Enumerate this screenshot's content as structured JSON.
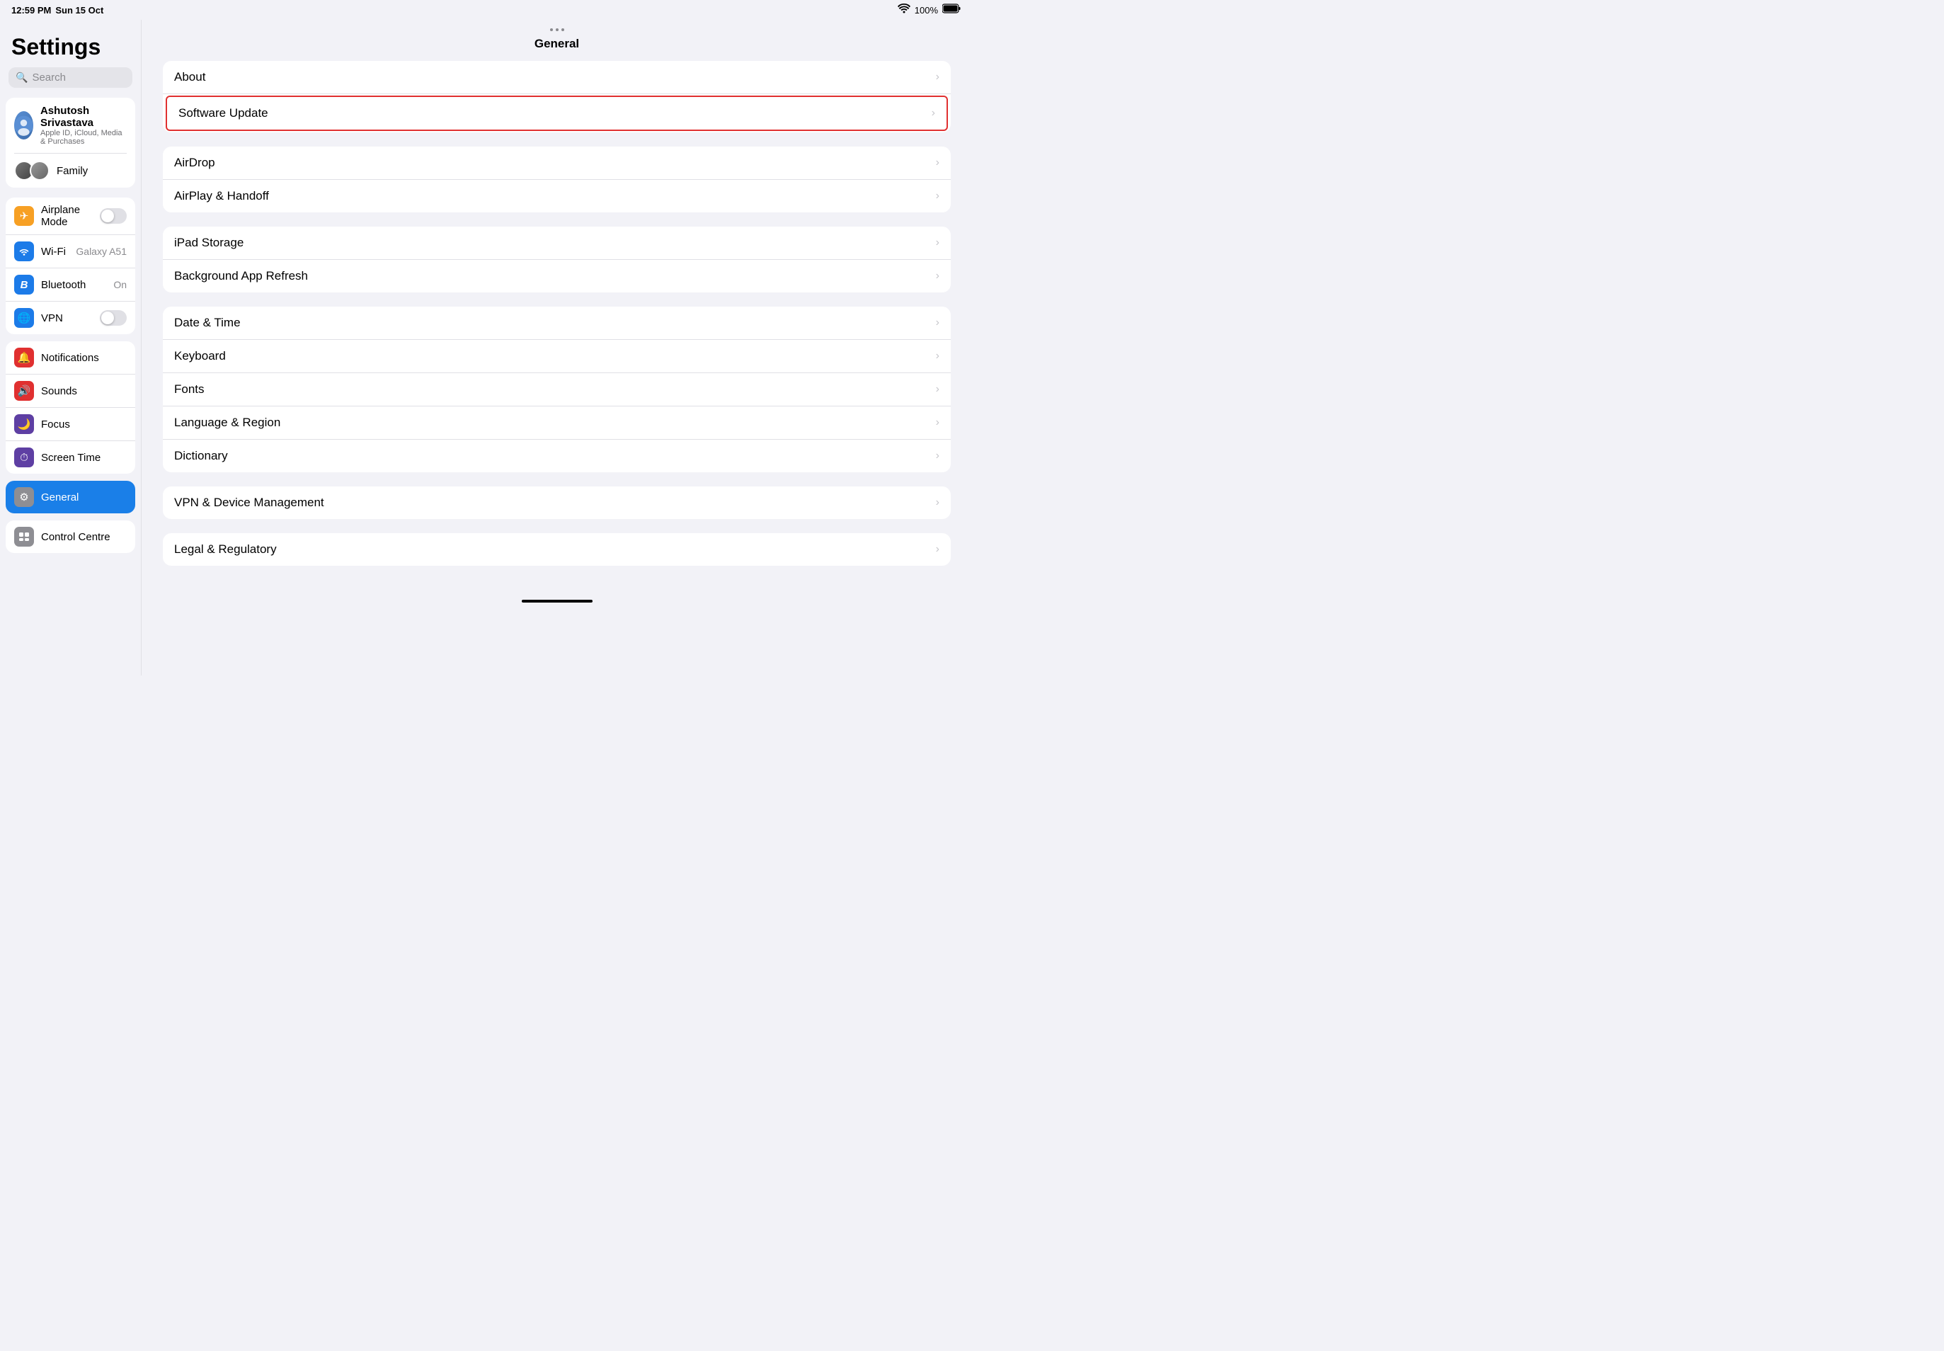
{
  "statusBar": {
    "time": "12:59 PM",
    "date": "Sun 15 Oct",
    "wifi": "100%",
    "battery": "100%"
  },
  "sidebar": {
    "title": "Settings",
    "search": {
      "placeholder": "Search"
    },
    "profile": {
      "name": "Ashutosh Srivastava",
      "subtitle": "Apple ID, iCloud, Media & Purchases",
      "family": "Family"
    },
    "groups": [
      {
        "items": [
          {
            "id": "airplane",
            "icon": "✈",
            "iconBg": "#f7a024",
            "label": "Airplane Mode",
            "type": "toggle",
            "toggleOn": false
          },
          {
            "id": "wifi",
            "icon": "📶",
            "iconBg": "#1c7be8",
            "label": "Wi-Fi",
            "value": "Galaxy A51",
            "type": "nav"
          },
          {
            "id": "bluetooth",
            "icon": "B",
            "iconBg": "#1c7be8",
            "label": "Bluetooth",
            "value": "On",
            "type": "nav"
          },
          {
            "id": "vpn",
            "icon": "🌐",
            "iconBg": "#1c7be8",
            "label": "VPN",
            "type": "toggle",
            "toggleOn": false
          }
        ]
      },
      {
        "items": [
          {
            "id": "notifications",
            "icon": "🔔",
            "iconBg": "#e03030",
            "label": "Notifications",
            "type": "nav"
          },
          {
            "id": "sounds",
            "icon": "🔊",
            "iconBg": "#e03030",
            "label": "Sounds",
            "type": "nav"
          },
          {
            "id": "focus",
            "icon": "🌙",
            "iconBg": "#5e3fa3",
            "label": "Focus",
            "type": "nav"
          },
          {
            "id": "screentime",
            "icon": "⏱",
            "iconBg": "#5e3fa3",
            "label": "Screen Time",
            "type": "nav"
          }
        ]
      },
      {
        "items": [
          {
            "id": "general",
            "icon": "⚙",
            "iconBg": "#8e8e93",
            "label": "General",
            "type": "nav",
            "active": true
          }
        ]
      },
      {
        "items": [
          {
            "id": "controlcentre",
            "icon": "☰",
            "iconBg": "#8e8e93",
            "label": "Control Centre",
            "type": "nav"
          }
        ]
      }
    ]
  },
  "detail": {
    "title": "General",
    "groups": [
      {
        "items": [
          {
            "label": "About",
            "highlighted": false
          },
          {
            "label": "Software Update",
            "highlighted": true
          }
        ]
      },
      {
        "items": [
          {
            "label": "AirDrop",
            "highlighted": false
          },
          {
            "label": "AirPlay & Handoff",
            "highlighted": false
          }
        ]
      },
      {
        "items": [
          {
            "label": "iPad Storage",
            "highlighted": false
          },
          {
            "label": "Background App Refresh",
            "highlighted": false
          }
        ]
      },
      {
        "items": [
          {
            "label": "Date & Time",
            "highlighted": false
          },
          {
            "label": "Keyboard",
            "highlighted": false
          },
          {
            "label": "Fonts",
            "highlighted": false
          },
          {
            "label": "Language & Region",
            "highlighted": false
          },
          {
            "label": "Dictionary",
            "highlighted": false
          }
        ]
      },
      {
        "items": [
          {
            "label": "VPN & Device Management",
            "highlighted": false
          }
        ]
      },
      {
        "items": [
          {
            "label": "Legal & Regulatory",
            "highlighted": false
          }
        ]
      }
    ]
  }
}
